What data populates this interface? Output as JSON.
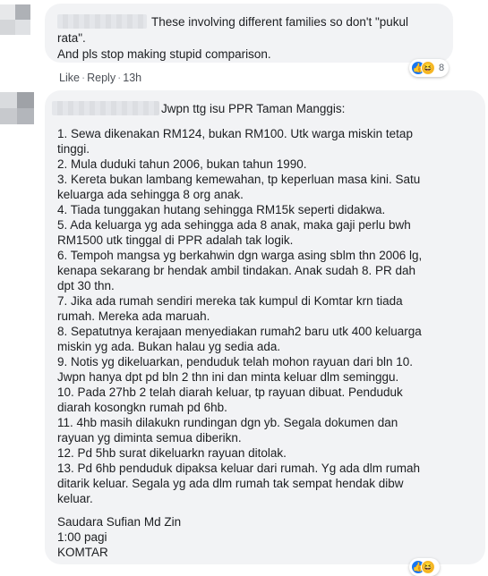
{
  "comment1": {
    "text_lines": [
      "These involving different families so don't \"pukul",
      "rata\".",
      "And pls stop making stupid comparison."
    ],
    "actions": {
      "like": "Like",
      "reply": "Reply",
      "time": "13h"
    },
    "reactions": {
      "icons": [
        "like-icon",
        "haha-icon"
      ],
      "count": "8"
    }
  },
  "comment2": {
    "heading": "Jwpn ttg isu PPR Taman Manggis:",
    "body_lines": [
      "1. Sewa dikenakan RM124, bukan RM100. Utk warga miskin tetap",
      "tinggi.",
      "2. Mula duduki tahun 2006, bukan tahun 1990.",
      "3. Kereta bukan lambang kemewahan, tp keperluan masa kini. Satu",
      "keluarga ada sehingga 8 org anak.",
      "4. Tiada tunggakan hutang sehingga RM15k seperti didakwa.",
      "5. Ada keluarga yg ada sehingga ada 8 anak, maka gaji perlu bwh",
      "RM1500 utk tinggal di PPR adalah tak logik.",
      "6. Tempoh mangsa yg berkahwin dgn warga asing sblm thn 2006 lg,",
      "kenapa sekarang br hendak ambil tindakan. Anak sudah 8. PR dah",
      "dpt 30 thn.",
      "7. Jika ada rumah sendiri mereka tak kumpul di Komtar krn tiada",
      "rumah. Mereka ada maruah.",
      "8. Sepatutnya kerajaan menyediakan rumah2 baru utk 400 keluarga",
      "miskin yg ada. Bukan halau yg sedia ada.",
      "9. Notis yg dikeluarkan, penduduk telah mohon rayuan dari bln 10.",
      "Jwpn hanya dpt pd bln 2 thn ini dan minta keluar dlm seminggu.",
      "10. Pada 27hb 2 telah diarah keluar, tp rayuan dibuat. Penduduk",
      "diarah kosongkn rumah pd 6hb.",
      "11. 4hb masih dilakukn rundingan dgn yb. Segala dokumen dan",
      "rayuan yg diminta semua diberikn.",
      "12. Pd 5hb surat dikeluarkn rayuan ditolak.",
      "13. Pd 6hb penduduk dipaksa keluar dari rumah. Yg ada dlm rumah",
      "ditarik keluar. Segala yg ada dlm rumah tak sempat hendak dibw",
      "keluar."
    ],
    "signature_lines": [
      "Saudara Sufian Md Zin",
      "1:00 pagi",
      "KOMTAR"
    ]
  },
  "colors": {
    "bubble": "#f2f3f5",
    "text": "#1c1e21",
    "meta": "#606770",
    "like_blue": "#1877f2",
    "haha_yellow": "#f7b928"
  }
}
